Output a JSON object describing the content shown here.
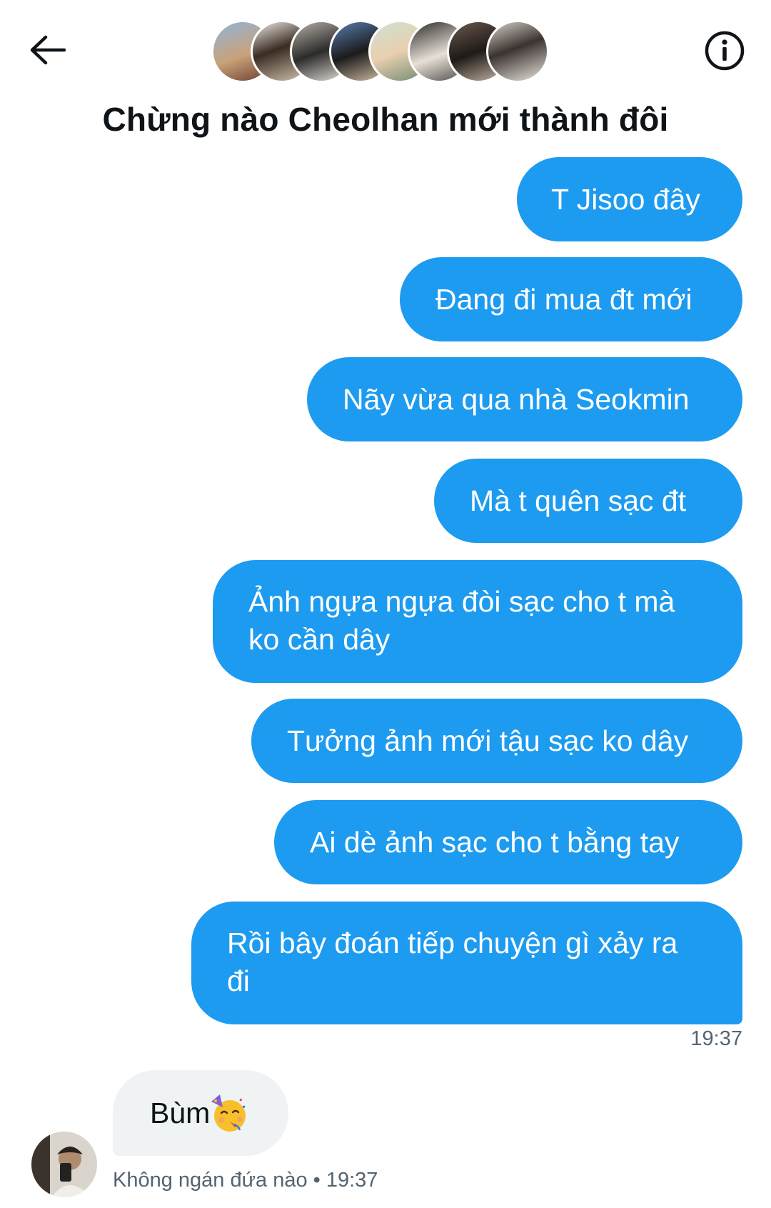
{
  "header": {
    "title": "Chừng nào Cheolhan mới thành đôi",
    "back_icon": "arrow-left-icon",
    "info_icon": "info-circle-icon",
    "participant_count": 8
  },
  "messages_sent": [
    {
      "text": "T Jisoo đây"
    },
    {
      "text": "Đang đi mua đt mới"
    },
    {
      "text": "Nãy vừa qua nhà Seokmin"
    },
    {
      "text": "Mà t quên sạc đt"
    },
    {
      "text": "Ảnh ngựa ngựa đòi sạc cho t mà ko cần dây"
    },
    {
      "text": "Tưởng ảnh mới tậu sạc ko dây"
    },
    {
      "text": "Ai dè ảnh sạc cho t bằng tay"
    },
    {
      "text": "Rồi bây đoán tiếp chuyện gì xảy ra đi"
    }
  ],
  "sent_time": "19:37",
  "received": {
    "text": "Bùm",
    "emoji": "partying-face-emoji",
    "meta": "Không ngán đứa nào • 19:37"
  },
  "colors": {
    "sent_bubble": "#1d9bf0",
    "received_bubble": "#eff3f4",
    "muted_text": "#536471"
  }
}
